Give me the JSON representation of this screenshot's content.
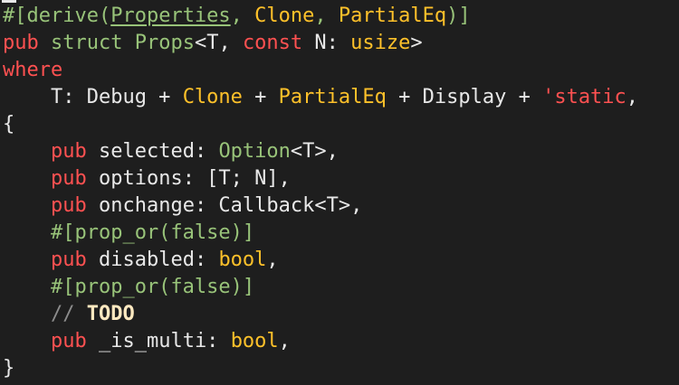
{
  "editor": {
    "language": "rust",
    "lines": [
      [
        {
          "t": "#[derive(",
          "c": "gr"
        },
        {
          "t": "Properties",
          "c": "gr",
          "u": true
        },
        {
          "t": ", ",
          "c": "gr"
        },
        {
          "t": "Clone",
          "c": "ty"
        },
        {
          "t": ", ",
          "c": "gr"
        },
        {
          "t": "PartialEq",
          "c": "ty"
        },
        {
          "t": ")]",
          "c": "gr"
        }
      ],
      [
        {
          "t": "pub",
          "c": "kw"
        },
        {
          "t": " struct ",
          "c": "gr"
        },
        {
          "t": "Props",
          "c": "gr"
        },
        {
          "t": "<T, ",
          "c": "nm"
        },
        {
          "t": "const",
          "c": "kw"
        },
        {
          "t": " N: ",
          "c": "nm"
        },
        {
          "t": "usize",
          "c": "ty"
        },
        {
          "t": ">",
          "c": "nm"
        }
      ],
      [
        {
          "t": "where",
          "c": "kw"
        }
      ],
      [
        {
          "t": "    T: Debug + ",
          "c": "nm"
        },
        {
          "t": "Clone",
          "c": "ty"
        },
        {
          "t": " + ",
          "c": "nm"
        },
        {
          "t": "PartialEq",
          "c": "ty"
        },
        {
          "t": " + Display + ",
          "c": "nm"
        },
        {
          "t": "'static",
          "c": "kw"
        },
        {
          "t": ",",
          "c": "nm"
        }
      ],
      [
        {
          "t": "{",
          "c": "nm"
        }
      ],
      [
        {
          "t": "    ",
          "c": "nm"
        },
        {
          "t": "pub",
          "c": "kw"
        },
        {
          "t": " selected: ",
          "c": "nm"
        },
        {
          "t": "Option",
          "c": "gr"
        },
        {
          "t": "<T>,",
          "c": "nm"
        }
      ],
      [
        {
          "t": "    ",
          "c": "nm"
        },
        {
          "t": "pub",
          "c": "kw"
        },
        {
          "t": " options: [T; N],",
          "c": "nm"
        }
      ],
      [
        {
          "t": "    ",
          "c": "nm"
        },
        {
          "t": "pub",
          "c": "kw"
        },
        {
          "t": " onchange: Callback<T>,",
          "c": "nm"
        }
      ],
      [
        {
          "t": "    #[prop_or(false)]",
          "c": "gr"
        }
      ],
      [
        {
          "t": "    ",
          "c": "nm"
        },
        {
          "t": "pub",
          "c": "kw"
        },
        {
          "t": " disabled: ",
          "c": "nm"
        },
        {
          "t": "bool",
          "c": "ty"
        },
        {
          "t": ",",
          "c": "nm"
        }
      ],
      [
        {
          "t": "    #[prop_or(false)]",
          "c": "gr"
        }
      ],
      [
        {
          "t": "    // ",
          "c": "cm"
        },
        {
          "t": "TODO",
          "c": "bold"
        }
      ],
      [
        {
          "t": "    ",
          "c": "nm"
        },
        {
          "t": "pub",
          "c": "kw"
        },
        {
          "t": " _is_multi: ",
          "c": "nm"
        },
        {
          "t": "bool",
          "c": "ty"
        },
        {
          "t": ",",
          "c": "nm"
        }
      ],
      [
        {
          "t": "}",
          "c": "nm"
        }
      ]
    ]
  }
}
